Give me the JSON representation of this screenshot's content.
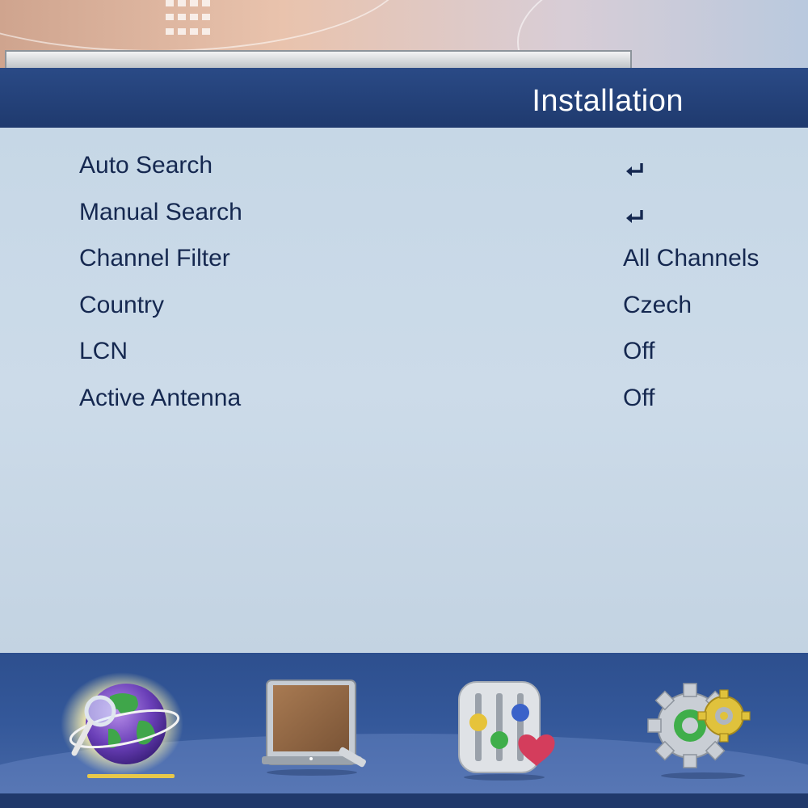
{
  "header": {
    "title": "Installation"
  },
  "menu": {
    "items": [
      {
        "label": "Auto Search",
        "value": "",
        "icon": "enter-icon"
      },
      {
        "label": "Manual Search",
        "value": "",
        "icon": "enter-icon"
      },
      {
        "label": "Channel Filter",
        "value": "All Channels"
      },
      {
        "label": "Country",
        "value": "Czech"
      },
      {
        "label": "LCN",
        "value": "Off"
      },
      {
        "label": "Active Antenna",
        "value": "Off"
      }
    ]
  },
  "bottom_nav": {
    "items": [
      {
        "icon": "globe-search-icon",
        "selected": true
      },
      {
        "icon": "tv-monitor-icon",
        "selected": false
      },
      {
        "icon": "mixer-heart-icon",
        "selected": false
      },
      {
        "icon": "gears-icon",
        "selected": false
      }
    ]
  },
  "colors": {
    "title_bar": "#1f3a6e",
    "panel": "#c9d9e8",
    "text": "#152850",
    "bottom_bar": "#34589a"
  }
}
